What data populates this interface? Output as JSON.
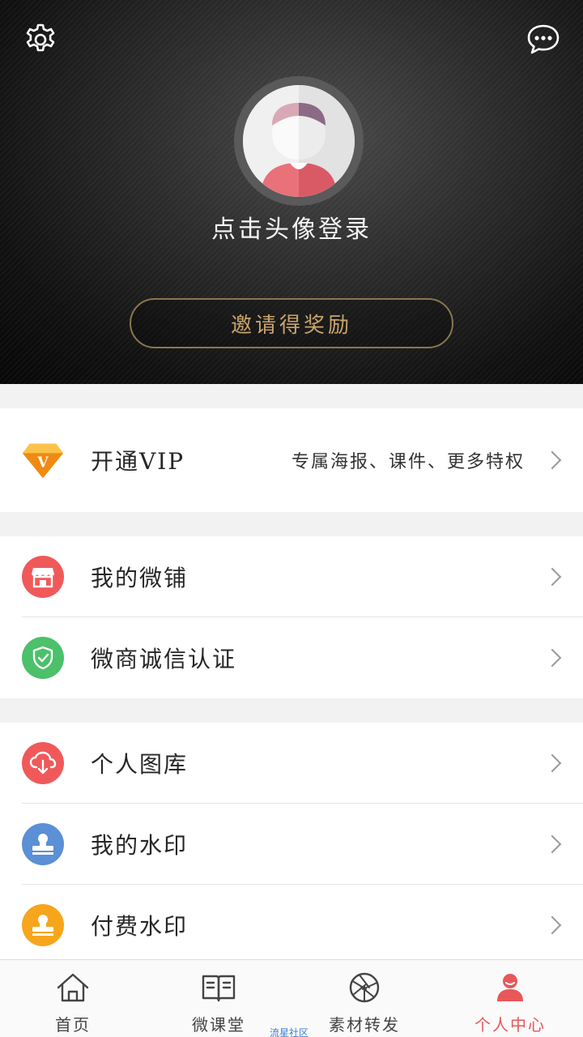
{
  "header": {
    "login_hint": "点击头像登录",
    "invite_label": "邀请得奖励",
    "icons": {
      "settings": "gear-icon",
      "message": "chat-bubble-icon"
    }
  },
  "vip": {
    "label": "开通VIP",
    "description": "专属海报、课件、更多特权",
    "icon": "diamond-v-icon",
    "icon_color": "#f5a623"
  },
  "shop_section": [
    {
      "label": "我的微铺",
      "icon": "store-icon",
      "color": "#f0595a"
    },
    {
      "label": "微商诚信认证",
      "icon": "shield-check-icon",
      "color": "#4cc06a"
    }
  ],
  "library_section": [
    {
      "label": "个人图库",
      "icon": "cloud-download-icon",
      "color": "#f0595a"
    },
    {
      "label": "我的水印",
      "icon": "stamp-icon",
      "color": "#5b8fd6"
    },
    {
      "label": "付费水印",
      "icon": "stamp-icon",
      "color": "#f7a51c"
    }
  ],
  "bottom_nav": [
    {
      "label": "首页",
      "icon": "home-icon",
      "active": false
    },
    {
      "label": "微课堂",
      "icon": "book-icon",
      "active": false
    },
    {
      "label": "素材转发",
      "icon": "aperture-icon",
      "active": false
    },
    {
      "label": "个人中心",
      "icon": "person-icon",
      "active": true
    }
  ],
  "watermark": "流星社区",
  "colors": {
    "accent": "#e8585a",
    "gold": "#c9a56a"
  }
}
